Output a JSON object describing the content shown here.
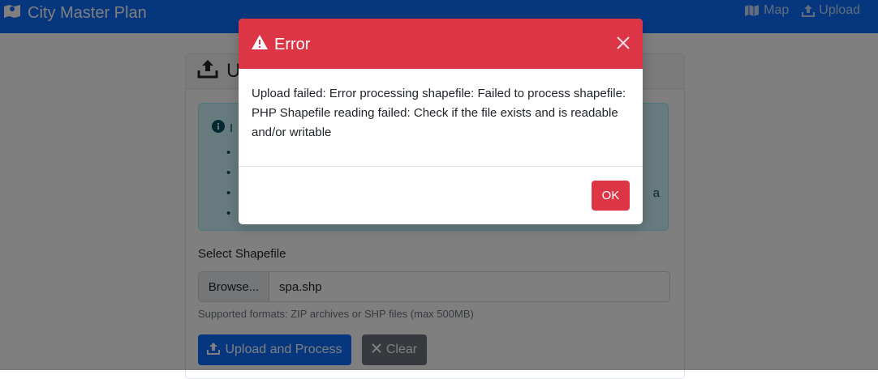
{
  "app": {
    "title": "City Master Plan"
  },
  "nav": {
    "items": [
      {
        "label": "Map",
        "icon": "map-icon"
      },
      {
        "label": "Upload",
        "icon": "upload-icon"
      }
    ]
  },
  "card": {
    "header_title": "U"
  },
  "info_alert": {
    "title": "I",
    "items": [
      "",
      "",
      "a",
      ""
    ]
  },
  "form": {
    "label": "Select Shapefile",
    "browse_label": "Browse...",
    "file_name": "spa.shp",
    "help_text": "Supported formats: ZIP archives or SHP files (max 500MB)",
    "upload_button": "Upload and Process",
    "clear_button": "Clear"
  },
  "modal": {
    "title": "Error",
    "message": "Upload failed: Error processing shapefile: Failed to process shapefile: PHP Shapefile reading failed: Check if the file exists and is readable and/or writable",
    "ok_button": "OK"
  },
  "colors": {
    "navbar": "#0d6efd",
    "danger": "#dc3545",
    "secondary": "#6c757d",
    "info_bg": "#cff4fc"
  }
}
